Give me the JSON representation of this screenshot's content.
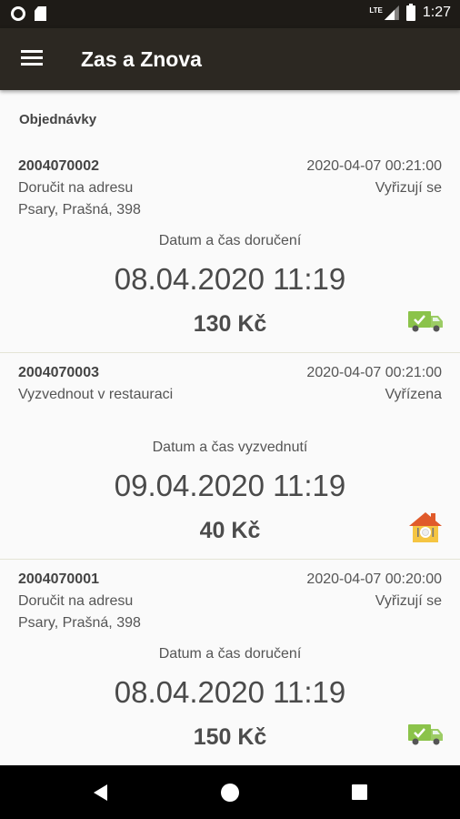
{
  "status": {
    "time": "1:27",
    "network": "LTE"
  },
  "appbar": {
    "title": "Zas a Znova"
  },
  "section_title": "Objednávky",
  "orders": [
    {
      "id": "2004070002",
      "created": "2020-04-07 00:21:00",
      "method": "Doručit na adresu",
      "status": "Vyřizují se",
      "address": "Psary, Prašná, 398",
      "time_label": "Datum a čas doručení",
      "datetime": "08.04.2020 11:19",
      "price": "130 Kč",
      "icon": "delivery-truck-icon"
    },
    {
      "id": "2004070003",
      "created": "2020-04-07 00:21:00",
      "method": "Vyzvednout v restauraci",
      "status": "Vyřízena",
      "address": "",
      "time_label": "Datum a čas vyzvednutí",
      "datetime": "09.04.2020 11:19",
      "price": "40 Kč",
      "icon": "restaurant-house-icon"
    },
    {
      "id": "2004070001",
      "created": "2020-04-07 00:20:00",
      "method": "Doručit na adresu",
      "status": "Vyřizují se",
      "address": "Psary, Prašná, 398",
      "time_label": "Datum a čas doručení",
      "datetime": "08.04.2020 11:19",
      "price": "150 Kč",
      "icon": "delivery-truck-icon"
    }
  ],
  "colors": {
    "appbar": "#2c2822",
    "statusbar": "#1e1b17",
    "truck": "#8bc34a",
    "house_roof": "#e05a2a"
  }
}
